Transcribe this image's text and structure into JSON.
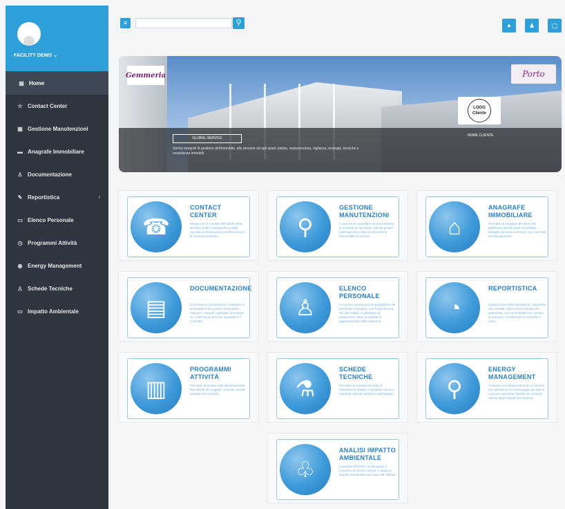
{
  "user": {
    "name": "FACILITY DEMO",
    "caret": "⌄"
  },
  "sidebar": {
    "home": "Home",
    "items": [
      {
        "label": "Contact Center",
        "icon": "☆"
      },
      {
        "label": "Gestione Manutenzioni",
        "icon": "▦"
      },
      {
        "label": "Anagrafe Immobiliare",
        "icon": "▬"
      },
      {
        "label": "Documentazione",
        "icon": "♙"
      },
      {
        "label": "Reportistica",
        "icon": "✎",
        "arrow": "‹"
      },
      {
        "label": "Elenco Personale",
        "icon": "▭"
      },
      {
        "label": "Programmi Attività",
        "icon": "◷"
      },
      {
        "label": "Energy Management",
        "icon": "◉"
      },
      {
        "label": "Schede Tecniche",
        "icon": "♙"
      },
      {
        "label": "Impatto Ambientale",
        "icon": "▭"
      }
    ]
  },
  "search": {
    "placeholder": "",
    "button_icon": "⚲"
  },
  "toolbar": {
    "menu_icon": "≡",
    "btn1_icon": "●",
    "btn2_icon": "♟",
    "btn3_icon": "▢"
  },
  "banner": {
    "logo_left": "Gemmeria",
    "logo_right": "Porto",
    "logo_cliente": "LOGO Cliente",
    "global_service": "GLOBAL SERVICE",
    "description": "Servizi integrati di gestione dell'immobile, alle persone ed agli spazi: pulizie, manutenzione, vigilanza, ecologia, tecniche e consulenza immobili.",
    "nome_cliente": "NOME CLIENTE"
  },
  "modules": [
    {
      "title": "CONTACT CENTER",
      "icon": "☎",
      "desc": "Modulo per il contatto dell'utente della struttura dalla segnalazione e dalla raccolta di informazioni ai centri servizi e la chiusura richiesta."
    },
    {
      "title": "GESTIONE MANUTENZIONI",
      "icon": "⚲",
      "desc": "Consente di controllare ed amministrare le richieste di intervento, tramite gestire interrogazioni e liste di comando la funzionalità di servizio."
    },
    {
      "title": "ANAGRAFE IMMOBILIARE",
      "icon": "⌂",
      "desc": "Permette di navigare all'interno del patrimonio gestito piani immobiliari, dettaglio da locali e dei beni, tra i vari sedi ed aree gestione."
    },
    {
      "title": "DOCUMENTAZIONE",
      "icon": "▤",
      "desc": "Consente la consultazione, il upload e il download di documenti (planimetrie, relazioni, manuali, capitolati, procedure ecc.) dei documenti che riguardano il contratto."
    },
    {
      "title": "ELENCO PERSONALE",
      "icon": "♙",
      "desc": "Le funzioni gestiscono le anagrafiche del personale impiegato, con l'importazione dei dati relativi, la gestione ed assunzione, tante possibilità di aggiornamento della relazione."
    },
    {
      "title": "REPORTISTICA",
      "icon": "◔",
      "desc": "Elaborazione della reportistica, rapportata dai contratti, informazioni inserite nel gestionale, che sono basate sui concetti di indicatori, di informazioni mediate e valori."
    },
    {
      "title": "PROGRAMMI ATTIVITÀ",
      "icon": "▥",
      "desc": "Permette di trovare tutte attività previste, fasi attività dei soggetti, richieste vendite previste nel contratto."
    },
    {
      "title": "SCHEDE TECNICHE",
      "icon": "⚗",
      "desc": "Permette di visualizzare tutte le informazioni relative ai prodotti chimici e materiali utilizzati all'interno dell'appalto."
    },
    {
      "title": "ENERGY MANAGEMENT",
      "icon": "⚲",
      "desc": "Gestione la configurazione di un sistema che attraverso lo monitoraggio dei dati di consumo permette l'analisi dei consumi rilevati degli impianti del sistema."
    },
    {
      "title": "ANALISI IMPATTO AMBIENTALE",
      "icon": "♧",
      "desc": "Consente di fornire, monitorando il consumo di risorse naturali, il grado di impatto ambientale associato alle attività."
    }
  ]
}
